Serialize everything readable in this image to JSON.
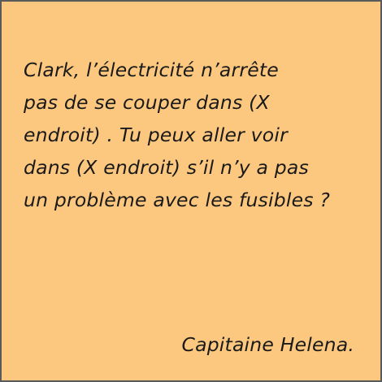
{
  "note": {
    "lines": [
      "Clark, l’électricité n’arrête",
      "pas de se couper dans (X",
      "endroit) . Tu peux aller voir",
      "dans (X endroit) s’il n’y a pas",
      "un problème avec les fusibles ?"
    ],
    "signature": "Capitaine Helena."
  },
  "colors": {
    "background": "#fcc77e",
    "border": "#5a5a5a",
    "text": "#1a1a1a"
  }
}
